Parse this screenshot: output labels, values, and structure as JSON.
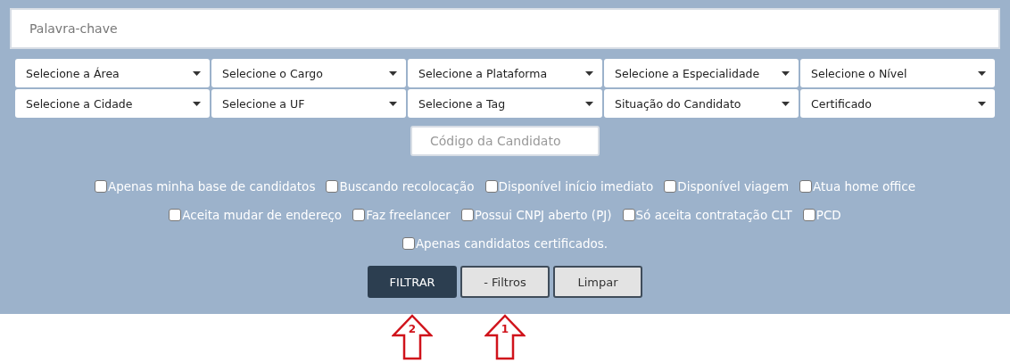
{
  "keyword_field": {
    "placeholder": "Palavra-chave"
  },
  "selects": [
    {
      "label": "Selecione a Área"
    },
    {
      "label": "Selecione o Cargo"
    },
    {
      "label": "Selecione a Plataforma"
    },
    {
      "label": "Selecione a Especialidade"
    },
    {
      "label": "Selecione o Nível"
    },
    {
      "label": "Selecione a Cidade"
    },
    {
      "label": "Selecione a UF"
    },
    {
      "label": "Selecione a Tag"
    },
    {
      "label": "Situação do Candidato"
    },
    {
      "label": "Certificado"
    }
  ],
  "code_field": {
    "placeholder": "Código da Candidato"
  },
  "checkbox_rows": [
    [
      {
        "label": "Apenas minha base de candidatos",
        "checked": false
      },
      {
        "label": "Buscando recolocação",
        "checked": false
      },
      {
        "label": "Disponível início imediato",
        "checked": false
      },
      {
        "label": "Disponível viagem",
        "checked": false
      },
      {
        "label": "Atua home office",
        "checked": false
      }
    ],
    [
      {
        "label": "Aceita mudar de endereço",
        "checked": false
      },
      {
        "label": "Faz freelancer",
        "checked": false
      },
      {
        "label": "Possui CNPJ aberto (PJ)",
        "checked": false
      },
      {
        "label": "Só aceita contratação CLT",
        "checked": false
      },
      {
        "label": "PCD",
        "checked": false
      }
    ],
    [
      {
        "label": "Apenas candidatos certificados.",
        "checked": false
      }
    ]
  ],
  "buttons": [
    {
      "label": "FILTRAR",
      "kind": "primary",
      "annotation": "2"
    },
    {
      "label": "- Filtros",
      "kind": "secondary",
      "annotation": "1"
    },
    {
      "label": "Limpar",
      "kind": "secondary"
    }
  ]
}
